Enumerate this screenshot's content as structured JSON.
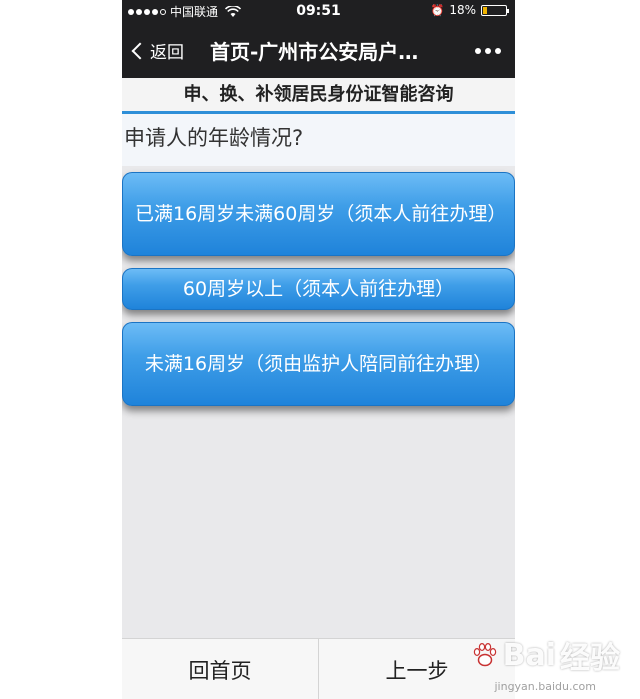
{
  "status_bar": {
    "carrier": "中国联通",
    "time": "09:51",
    "battery": "18%",
    "battery_level": 0.18
  },
  "nav": {
    "back_label": "返回",
    "title": "首页-广州市公安局户…"
  },
  "header": {
    "title": "申、换、补领居民身份证智能咨询"
  },
  "question": {
    "text": "申请人的年龄情况?"
  },
  "options": [
    {
      "label": "已满16周岁未满60周岁（须本人前往办理）"
    },
    {
      "label": "60周岁以上（须本人前往办理）"
    },
    {
      "label": "未满16周岁（须由监护人陪同前往办理）"
    }
  ],
  "bottom": {
    "home_label": "回首页",
    "prev_label": "上一步"
  },
  "watermark": {
    "brand": "Bai",
    "brand_cn": "经验",
    "url": "jingyan.baidu.com"
  },
  "colors": {
    "nav_bg": "#1f1f21",
    "accent": "#2e8fd8",
    "option_blue": "#3f9ee8",
    "battery": "#f0b400"
  }
}
